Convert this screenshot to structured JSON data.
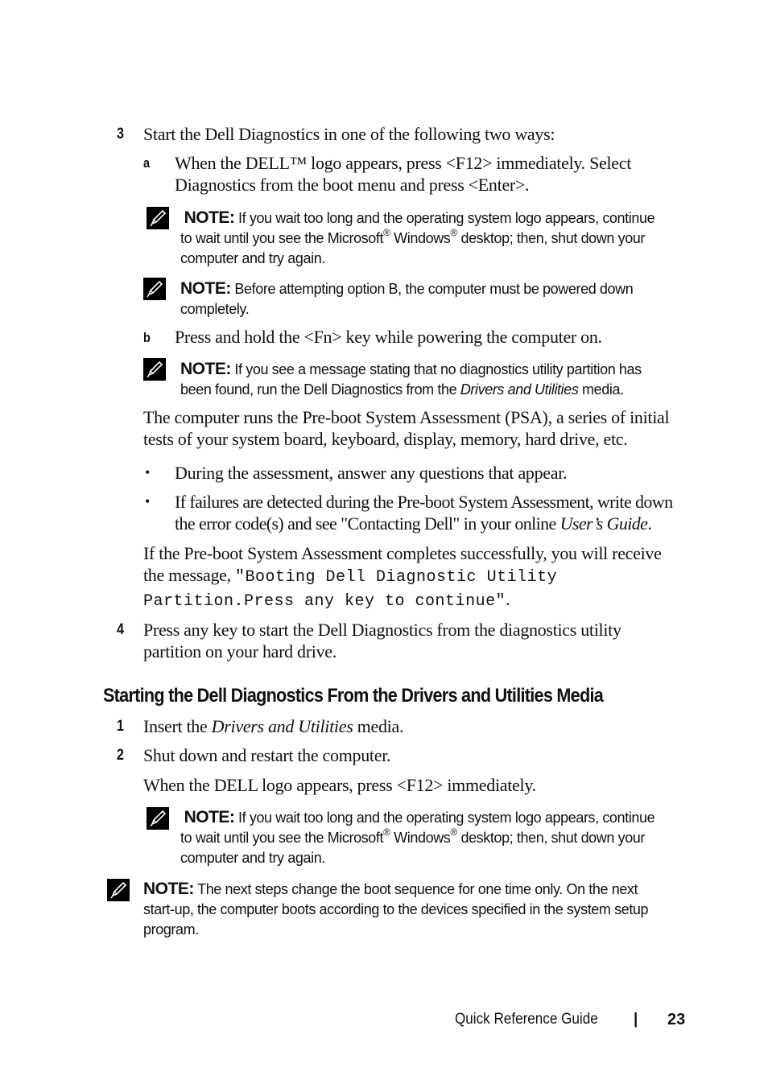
{
  "steps_top": {
    "step3": {
      "number": "3",
      "text": "Start the Dell Diagnostics in one of the following two ways:",
      "option_a": {
        "letter": "a",
        "line1": "When the DELL™ logo appears, press <F12> immediately. Select",
        "line2": "Diagnostics from the boot menu and press <Enter>."
      },
      "note1": {
        "label": "NOTE:",
        "line1": " If you wait too long and the operating system logo appears, continue",
        "line2_a": "to wait until you see the Microsoft",
        "reg": "®",
        "line2_b": " Windows",
        "line2_c": " desktop; then, shut down your",
        "line3": "computer and try again."
      },
      "note2": {
        "label": "NOTE:",
        "line1": " Before attempting option B, the computer must be powered down",
        "line2": "completely."
      },
      "option_b": {
        "letter": "b",
        "text": "Press and hold the <Fn> key while powering the computer on."
      },
      "note3": {
        "label": "NOTE:",
        "line1": " If you see a message stating that no diagnostics utility partition has",
        "line2_a": "been found, run the Dell Diagnostics from the ",
        "line2_italic": "Drivers and Utilities",
        "line2_b": " media."
      },
      "psa_para": {
        "line1": "The computer runs the Pre-boot System Assessment (PSA), a series of initial",
        "line2": "tests of your system board, keyboard, display, memory, hard drive, etc."
      },
      "bullets": [
        {
          "symbol": "•",
          "line1": "During the assessment, answer any questions that appear."
        },
        {
          "symbol": "•",
          "line1": "If failures are detected during the Pre-boot System Assessment, write down",
          "line2_a": "the error code(s) and see \"Contacting Dell\" in your online ",
          "line2_italic": "User’s Guide",
          "line2_b": "."
        }
      ],
      "success_para": {
        "line1": "If the Pre-boot System Assessment completes successfully, you will receive",
        "line2_a": "the message, ",
        "code1": "\"Booting Dell Diagnostic Utility",
        "code2": "Partition.Press any key to continue\"",
        "end": "."
      }
    },
    "step4": {
      "number": "4",
      "line1": "Press any key to start the Dell Diagnostics from the diagnostics utility",
      "line2": "partition on your hard drive."
    }
  },
  "section": {
    "heading": "Starting the Dell Diagnostics From the Drivers and Utilities Media",
    "step1": {
      "number": "1",
      "text_a": "Insert the ",
      "text_italic": "Drivers and Utilities",
      "text_b": " media."
    },
    "step2": {
      "number": "2",
      "text": "Shut down and restart the computer.",
      "followup": "When the DELL logo appears, press <F12> immediately."
    },
    "note4": {
      "label": "NOTE:",
      "line1": " If you wait too long and the operating system logo appears, continue",
      "line2_a": "to wait until you see the Microsoft",
      "reg": "®",
      "line2_b": " Windows",
      "line2_c": " desktop; then, shut down your",
      "line3": "computer and try again."
    },
    "note5": {
      "label": "NOTE:",
      "line1": " The next steps change the boot sequence for one time only. On the next",
      "line2": "start-up, the computer boots according to the devices specified in the system setup",
      "line3": "program."
    }
  },
  "footer": {
    "guide_title": "Quick Reference Guide",
    "separator": "|",
    "page_number": "23"
  }
}
